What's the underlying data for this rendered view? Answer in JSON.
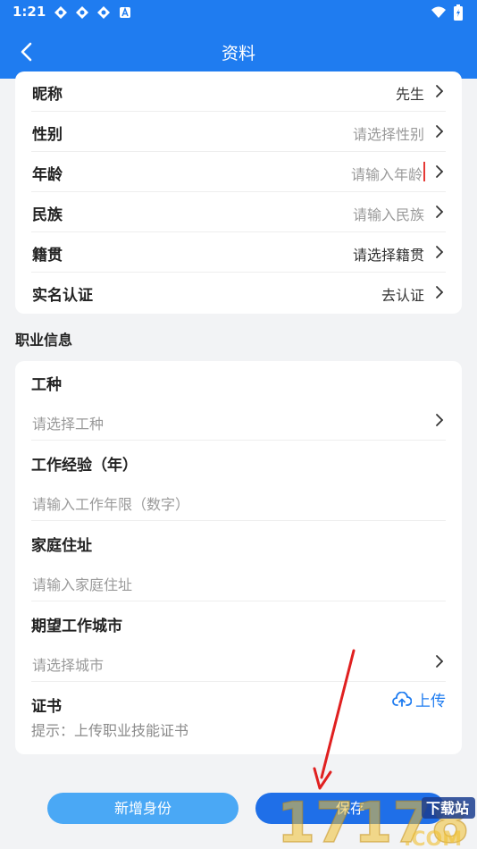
{
  "status_bar": {
    "time": "1:21"
  },
  "nav": {
    "title": "资料"
  },
  "profile_rows": [
    {
      "label": "昵称",
      "value": "先生",
      "placeholder": false
    },
    {
      "label": "性别",
      "value": "请选择性别",
      "placeholder": true
    },
    {
      "label": "年龄",
      "value": "请输入年龄",
      "placeholder": true
    },
    {
      "label": "民族",
      "value": "请输入民族",
      "placeholder": true
    },
    {
      "label": "籍贯",
      "value": "请选择籍贯",
      "placeholder": false
    },
    {
      "label": "实名认证",
      "value": "去认证",
      "placeholder": false
    }
  ],
  "career": {
    "section_title": "职业信息",
    "work_type_label": "工种",
    "work_type_placeholder": "请选择工种",
    "experience_label": "工作经验（年）",
    "experience_placeholder": "请输入工作年限（数字）",
    "address_label": "家庭住址",
    "address_placeholder": "请输入家庭住址",
    "city_label": "期望工作城市",
    "city_placeholder": "请选择城市",
    "certificate_label": "证书",
    "upload_label": "上传",
    "certificate_hint": "提示：上传职业技能证书"
  },
  "buttons": {
    "add_identity": "新增身份",
    "save": "保存"
  },
  "watermark": {
    "text": "17178.com",
    "badge": "下载站"
  },
  "colors": {
    "primary": "#1f7cf0",
    "secondary_button": "#4aa8f5",
    "background": "#f2f3f5",
    "arrow": "#e02020"
  }
}
